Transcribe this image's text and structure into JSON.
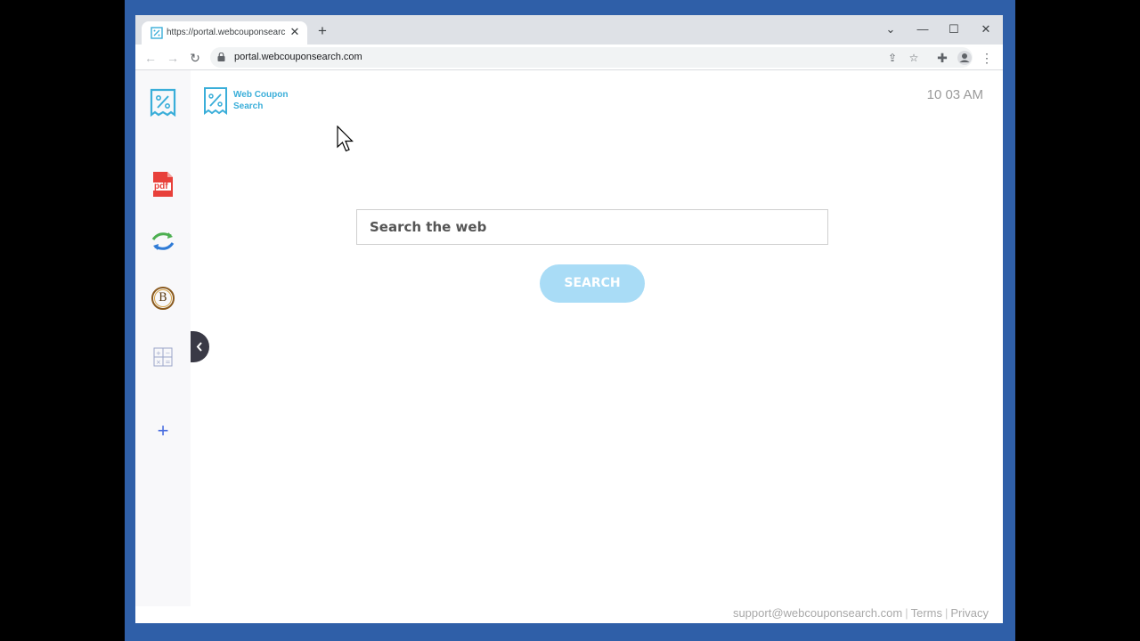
{
  "browser": {
    "tab": {
      "title": "https://portal.webcouponsearch.c",
      "close_label": "✕"
    },
    "new_tab_label": "+",
    "url": "portal.webcouponsearch.com"
  },
  "header": {
    "logo_line1": "Web Coupon",
    "logo_line2": "Search",
    "clock": "10 03 AM"
  },
  "search": {
    "placeholder": "Search the web",
    "button_label": "SEARCH"
  },
  "sidebar": {
    "items": [
      {
        "icon": "coupon-logo-icon"
      },
      {
        "icon": "pdf-icon",
        "label": "pdf"
      },
      {
        "icon": "converter-icon"
      },
      {
        "icon": "bitcoin-icon",
        "label": "B"
      },
      {
        "icon": "calculator-icon"
      },
      {
        "icon": "plus-icon",
        "label": "+"
      }
    ]
  },
  "footer": {
    "email": "support@webcouponsearch.com",
    "terms": "Terms",
    "privacy": "Privacy"
  },
  "colors": {
    "accent": "#3aaed9",
    "search_button": "#a9dcf6",
    "desktop": "#2f5fa8"
  }
}
